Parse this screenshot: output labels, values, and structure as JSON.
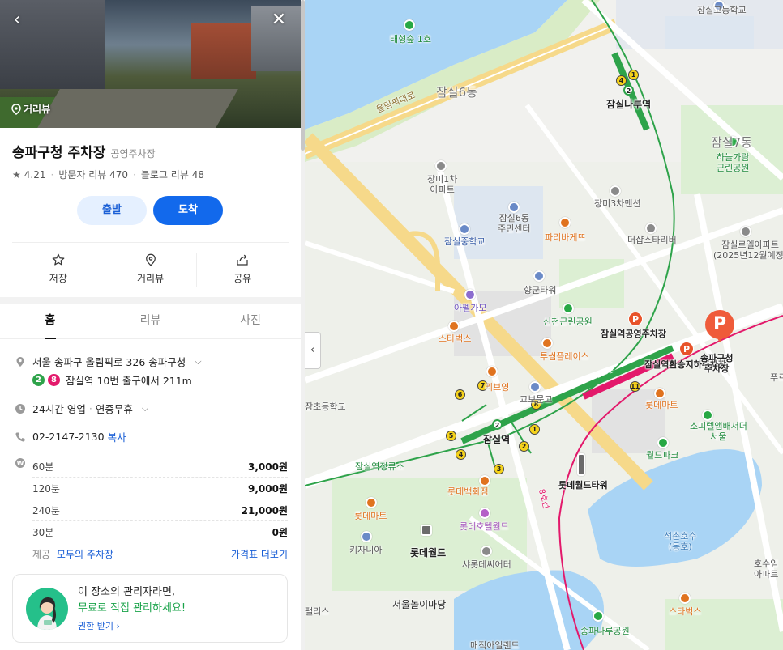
{
  "panel": {
    "roadview_tag": "거리뷰",
    "place_name": "송파구청 주차장",
    "category": "공영주차장",
    "rating": "4.21",
    "visitor_reviews": "방문자 리뷰 470",
    "blog_reviews": "블로그 리뷰 48",
    "depart_label": "출발",
    "arrive_label": "도착",
    "actions": [
      "저장",
      "거리뷰",
      "공유"
    ],
    "tabs": [
      "홈",
      "리뷰",
      "사진"
    ],
    "address": "서울 송파구 올림픽로 326 송파구청",
    "subway_lines": [
      "2",
      "8"
    ],
    "subway_text": "잠실역 10번 출구에서 211m",
    "hours": "24시간 영업",
    "hours_extra": "연중무휴",
    "phone": "02-2147-2130",
    "copy_label": "복사",
    "prices": [
      {
        "time": "60분",
        "price": "3,000원"
      },
      {
        "time": "120분",
        "price": "9,000원"
      },
      {
        "time": "240분",
        "price": "21,000원"
      },
      {
        "time": "30분",
        "price": "0원"
      }
    ],
    "provided_label": "제공",
    "provider": "모두의 주차장",
    "more_prices": "가격표 더보기",
    "owner_line1": "이 장소의 관리자라면,",
    "owner_line2": "무료로 직접 관리하세요!",
    "owner_link": "권한 받기"
  },
  "map": {
    "labels": {
      "taehyung": "태형숲 1호",
      "jamsil_highschool": "잠실고등학교",
      "jamsil6": "잠실6동",
      "olympic_road": "올림픽대로",
      "jamsilnaru": "잠실나루역",
      "jamsil7": "잠실7동",
      "haneul_park": "하늘가람\n근린공원",
      "jangmi1": "장미1차\n아파트",
      "jangmi3": "장미3차맨션",
      "jamsil6_center": "잠실6동\n주민센터",
      "jamsil_middle": "잠실중학교",
      "paris": "파리바게뜨",
      "dusap": "더샵스타리버",
      "jamsil_ell": "잠실르엘아파트\n(2025년12월예정)",
      "hyanggun": "향군타워",
      "apelgamo": "아펠가모",
      "shincheon": "신천근린공원",
      "starbucks1": "스타벅스",
      "twosome": "투썸플레이스",
      "public_parking": "잠실역공영주차장",
      "transfer_parking": "잠실역환승지하주차장",
      "songpa_parking": "송파구청\n주차장",
      "ribyeong": "리브영",
      "gyobo": "교보문고",
      "jamsil_station": "잠실역",
      "lotte_mart1": "롯데마트",
      "sofitel": "소피텔앰배서더\n서울",
      "world_park": "월드파크",
      "jamsil_stop": "잠실역정류소",
      "lotte_world_tower": "롯데월드타워",
      "lotte_dept": "롯데백화점",
      "lotte_hotel": "롯데호텔월드",
      "lotte_mart2": "롯데마트",
      "kidzania": "키자니아",
      "lotte_world": "롯데월드",
      "seokchon_lake": "석촌호수\n(동호)",
      "shadow_theater": "샤롯데씨어터",
      "hosu_apt": "호수임\n아파트",
      "seoul_play": "서울놀이마당",
      "starbucks2": "스타벅스",
      "palace": "팰리스",
      "songpa_naru": "송파나루공원",
      "magic_island": "매직아일랜드",
      "elementary": "잠초등학교",
      "line8": "8호선",
      "line2": "2호선",
      "pu": "푸르"
    }
  },
  "colors": {
    "accent": "#1269ec",
    "line2": "#2ea34a",
    "line8": "#e3196b",
    "parking": "#ef5b3a"
  }
}
